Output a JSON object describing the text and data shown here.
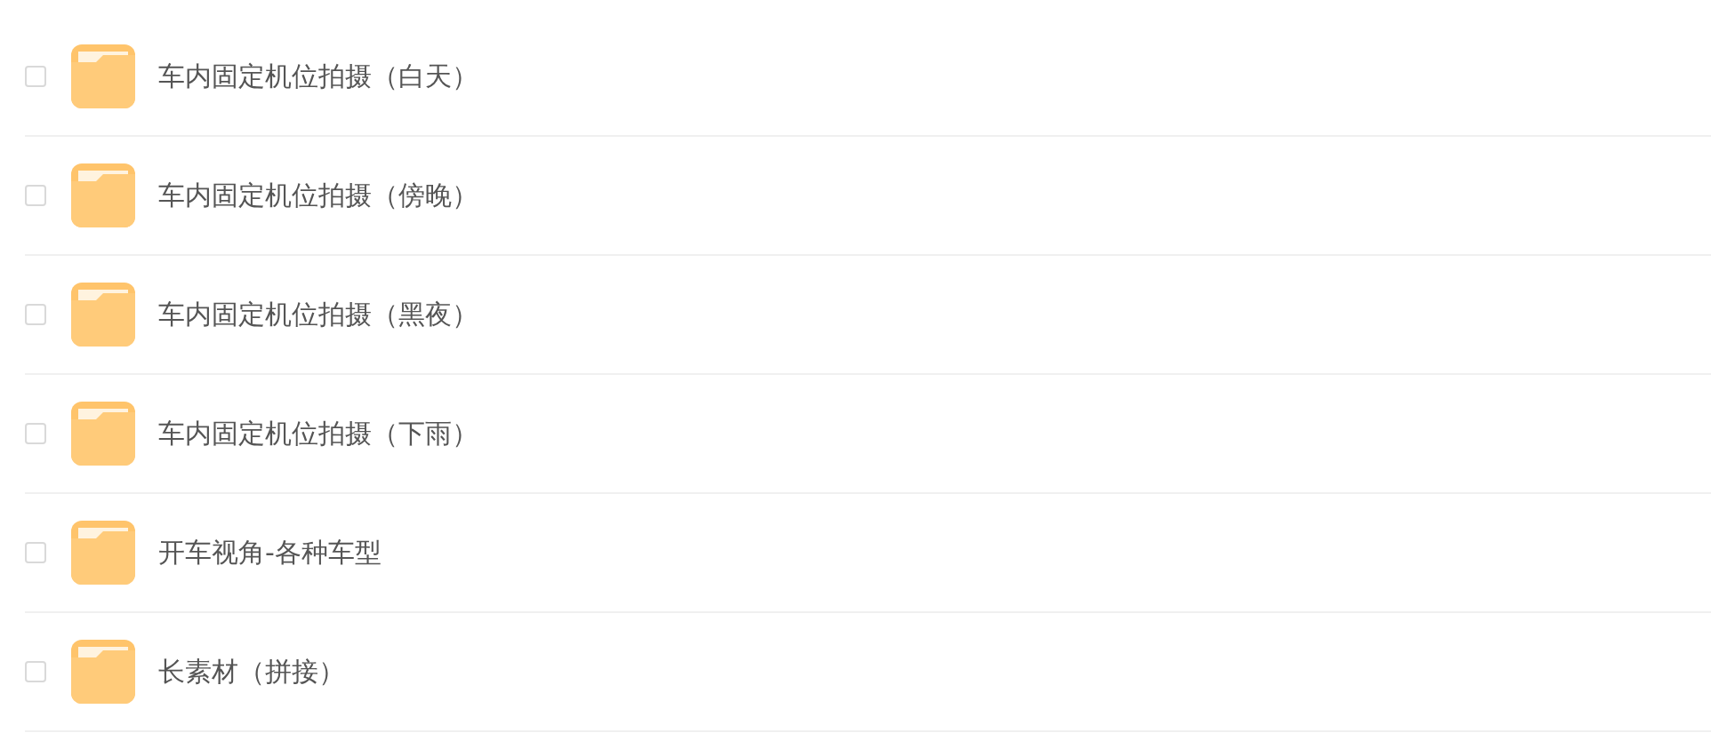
{
  "folders": [
    {
      "name": "车内固定机位拍摄（白天）",
      "checked": false
    },
    {
      "name": "车内固定机位拍摄（傍晚）",
      "checked": false
    },
    {
      "name": "车内固定机位拍摄（黑夜）",
      "checked": false
    },
    {
      "name": "车内固定机位拍摄（下雨）",
      "checked": false
    },
    {
      "name": "开车视角-各种车型",
      "checked": false
    },
    {
      "name": "长素材（拼接）",
      "checked": false
    }
  ]
}
